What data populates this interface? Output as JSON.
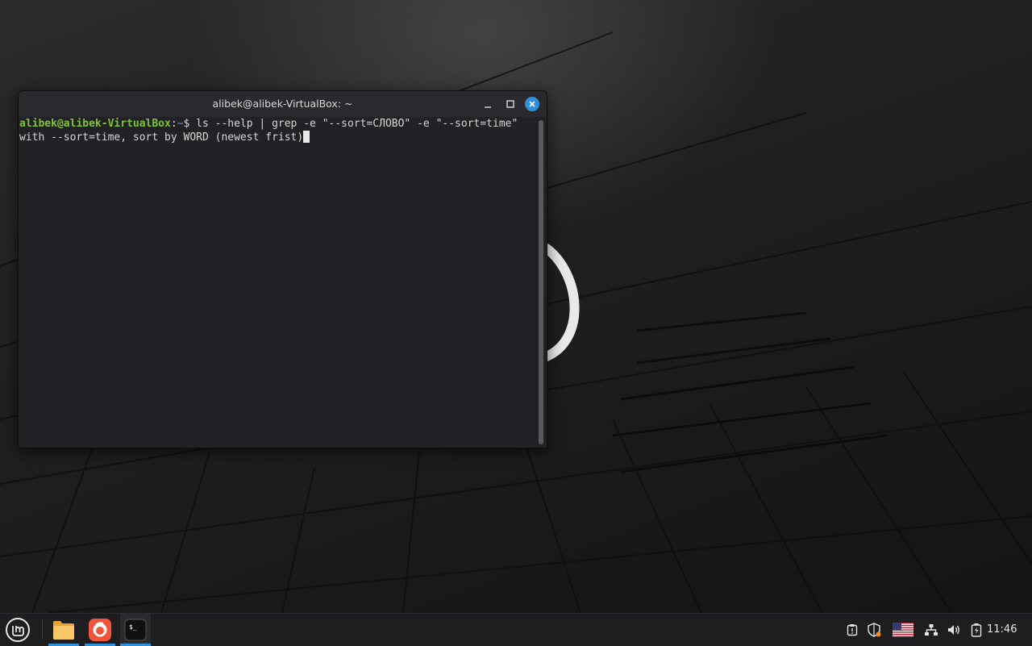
{
  "window": {
    "title": "alibek@alibek-VirtualBox: ~"
  },
  "terminal": {
    "prompt_user": "alibek@alibek-VirtualBox",
    "prompt_sep": ":",
    "prompt_path": "~",
    "prompt_symbol": "$ ",
    "command": "ls --help | grep -e \"--sort=СЛОВО\" -e \"--sort=time\"",
    "output": "with --sort=time, sort by WORD (newest frist)"
  },
  "taskbar": {
    "apps": [
      {
        "name": "mint-menu-icon"
      },
      {
        "name": "folder-icon"
      },
      {
        "name": "firefox-icon"
      },
      {
        "name": "terminal-icon"
      }
    ],
    "tray_icons": [
      "clipboard-icon",
      "shield-icon",
      "us-flag-icon",
      "network-icon",
      "volume-icon",
      "battery-icon"
    ],
    "clock": "11:46"
  },
  "colors": {
    "accent": "#2f8fd8",
    "prompt_user": "#7fc236",
    "prompt_path": "#4f9ed6",
    "terminal_bg": "#222226"
  }
}
